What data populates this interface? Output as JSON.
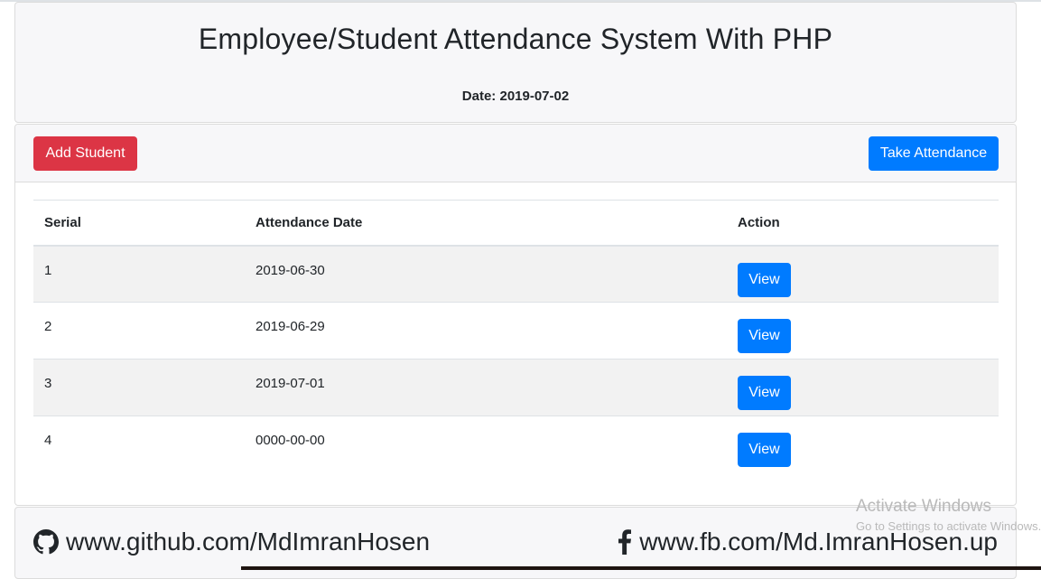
{
  "header": {
    "title": "Employee/Student Attendance System With PHP",
    "date_label": "Date: 2019-07-02"
  },
  "toolbar": {
    "add_label": "Add Student",
    "take_label": "Take Attendance"
  },
  "table": {
    "columns": [
      "Serial",
      "Attendance Date",
      "Action"
    ],
    "rows": [
      {
        "serial": "1",
        "date": "2019-06-30",
        "action": "View"
      },
      {
        "serial": "2",
        "date": "2019-06-29",
        "action": "View"
      },
      {
        "serial": "3",
        "date": "2019-07-01",
        "action": "View"
      },
      {
        "serial": "4",
        "date": "0000-00-00",
        "action": "View"
      }
    ]
  },
  "footer": {
    "github_text": "www.github.com/MdImranHosen",
    "github_icon": "github-icon",
    "fb_text": "www.fb.com/Md.ImranHosen.up",
    "fb_icon": "facebook-icon"
  },
  "watermark": {
    "title": "Activate Windows",
    "subtitle": "Go to Settings to activate Windows."
  },
  "colors": {
    "danger": "#dc3545",
    "primary": "#007bff"
  }
}
